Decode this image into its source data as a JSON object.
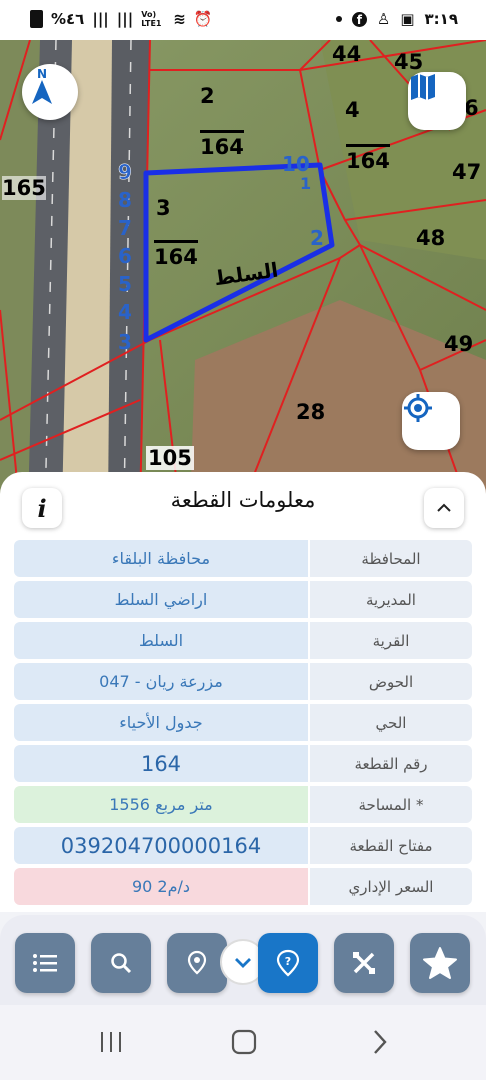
{
  "status": {
    "left_text": "%٤٦",
    "network": "Vo) LTE1",
    "time": "٣:١٩"
  },
  "map": {
    "parcel_labels": [
      "2",
      "4",
      "44",
      "45",
      "6",
      "165",
      "47",
      "48",
      "49",
      "28",
      "105",
      "3"
    ],
    "parcel_fractions": [
      {
        "top": "",
        "bottom": "164"
      },
      {
        "top": "",
        "bottom": "164"
      },
      {
        "top": "",
        "bottom": "164"
      }
    ],
    "vertex_labels": [
      "9",
      "8",
      "7",
      "6",
      "5",
      "4",
      "3",
      "10",
      "1",
      "2"
    ],
    "village_label": "السلط",
    "compass_letter": "N",
    "icons": {
      "compass": "north-arrow-icon",
      "layers": "map-layers-icon",
      "locate": "my-location-icon"
    }
  },
  "sheet": {
    "title": "معلومات القطعة",
    "info_icon": "i",
    "collapse_icon": "chevron-up-icon",
    "rows": [
      {
        "label": "المحافظة",
        "value": "محافظة البلقاء",
        "style": "blue"
      },
      {
        "label": "المديرية",
        "value": "اراضي السلط",
        "style": "blue"
      },
      {
        "label": "القرية",
        "value": "السلط",
        "style": "blue"
      },
      {
        "label": "الحوض",
        "value": "مزرعة ريان - 047",
        "style": "blue"
      },
      {
        "label": "الحي",
        "value": "جدول الأحياء",
        "style": "blue"
      },
      {
        "label": "رقم القطعة",
        "value": "164",
        "style": "blue big"
      },
      {
        "label": "المساحة *",
        "value": "1556  متر مربع",
        "style": "green"
      },
      {
        "label": "مفتاح القطعة",
        "value": "039204700000164",
        "style": "blue big"
      },
      {
        "label": "السعر الإداري",
        "value": "90 د/م2",
        "style": "red"
      }
    ]
  },
  "toolbar": {
    "buttons": [
      "list-icon",
      "search-icon",
      "pin-icon",
      "help-icon",
      "tools-icon",
      "star-icon"
    ],
    "active": "help-icon"
  },
  "colors": {
    "parcel_outline": "#1a2fe6",
    "boundary": "#e02020",
    "tool_bg": "#667f9a",
    "tool_active": "#1976c8"
  }
}
